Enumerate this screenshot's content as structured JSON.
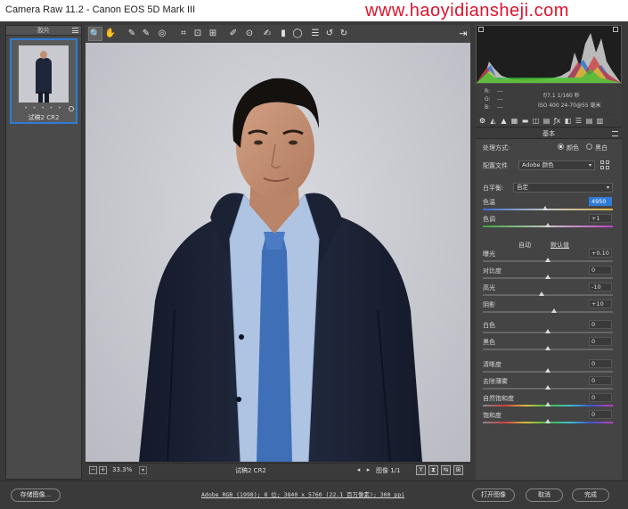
{
  "window": {
    "title": "Camera Raw 11.2 -  Canon EOS 5D Mark III",
    "watermark": "www.haoyidiansheji.com"
  },
  "filmstrip": {
    "header": "胶片",
    "thumb_stars": "• • • • •",
    "thumb_name": "试稿2 CR2"
  },
  "toolbar": {
    "tools": [
      {
        "name": "zoom-tool-icon",
        "glyph": "🔍"
      },
      {
        "name": "hand-tool-icon",
        "glyph": "✋"
      },
      {
        "name": "white-balance-tool-icon",
        "glyph": "✎"
      },
      {
        "name": "color-sampler-tool-icon",
        "glyph": "✎"
      },
      {
        "name": "targeted-adjustment-tool-icon",
        "glyph": "◎"
      },
      {
        "name": "crop-tool-icon",
        "glyph": "⌗"
      },
      {
        "name": "straighten-tool-icon",
        "glyph": "⊡"
      },
      {
        "name": "transform-tool-icon",
        "glyph": "⊞"
      },
      {
        "name": "spot-removal-tool-icon",
        "glyph": "✐"
      },
      {
        "name": "red-eye-tool-icon",
        "glyph": "⊙"
      },
      {
        "name": "adjustment-brush-icon",
        "glyph": "✍"
      },
      {
        "name": "graduated-filter-icon",
        "glyph": "▮"
      },
      {
        "name": "radial-filter-icon",
        "glyph": "◯"
      },
      {
        "name": "preferences-icon",
        "glyph": "☰"
      },
      {
        "name": "rotate-left-icon",
        "glyph": "↺"
      },
      {
        "name": "rotate-right-icon",
        "glyph": "↻"
      }
    ],
    "export_glyph": "⇥"
  },
  "image_status": {
    "zoom_minus": "−",
    "zoom_plus": "+",
    "zoom_value": "33.3%",
    "file_name": "试稿2 CR2",
    "page_info": "图像 1/1",
    "view_y": "Y",
    "view_2": "⧗",
    "view_3": "⇆",
    "view_4": "⊞"
  },
  "readout": {
    "r": "R:",
    "g": "G:",
    "b": "B:",
    "dash": "---",
    "aperture_shutter": "f/7.1   1/160 秒",
    "iso_lens": "ISO 400   24-70@55 毫米"
  },
  "panel": {
    "title": "基本",
    "treatment_label": "处理方式:",
    "treatment_color": "颜色",
    "treatment_bw": "黑白",
    "profile_label": "配置文件",
    "profile_value": "Adobe 颜色",
    "wb_label": "白平衡:",
    "wb_value": "自定",
    "auto_label": "自动",
    "default_label": "默认值",
    "sliders": [
      {
        "label": "色温",
        "value": "4950",
        "pos": 0.48
      },
      {
        "label": "色调",
        "value": "+1",
        "pos": 0.5
      },
      {
        "label": "曝光",
        "value": "+0.10",
        "pos": 0.5
      },
      {
        "label": "对比度",
        "value": "0",
        "pos": 0.5
      },
      {
        "label": "高光",
        "value": "-10",
        "pos": 0.45
      },
      {
        "label": "阴影",
        "value": "+10",
        "pos": 0.55
      },
      {
        "label": "白色",
        "value": "0",
        "pos": 0.5
      },
      {
        "label": "黑色",
        "value": "0",
        "pos": 0.5
      },
      {
        "label": "清晰度",
        "value": "0",
        "pos": 0.5
      },
      {
        "label": "去除薄雾",
        "value": "0",
        "pos": 0.5
      },
      {
        "label": "自然饱和度",
        "value": "0",
        "pos": 0.5
      },
      {
        "label": "饱和度",
        "value": "0",
        "pos": 0.5
      }
    ]
  },
  "bottom": {
    "save_label": "存储图像...",
    "info_text": "Adobe RGB (1998); 8 位; 3840 x 5760 (22.1 百万像素); 300 ppi",
    "open_label": "打开图像",
    "cancel_label": "取消",
    "done_label": "完成"
  },
  "colors": {
    "accent": "#2f7bd6",
    "watermark": "#e0132b"
  }
}
